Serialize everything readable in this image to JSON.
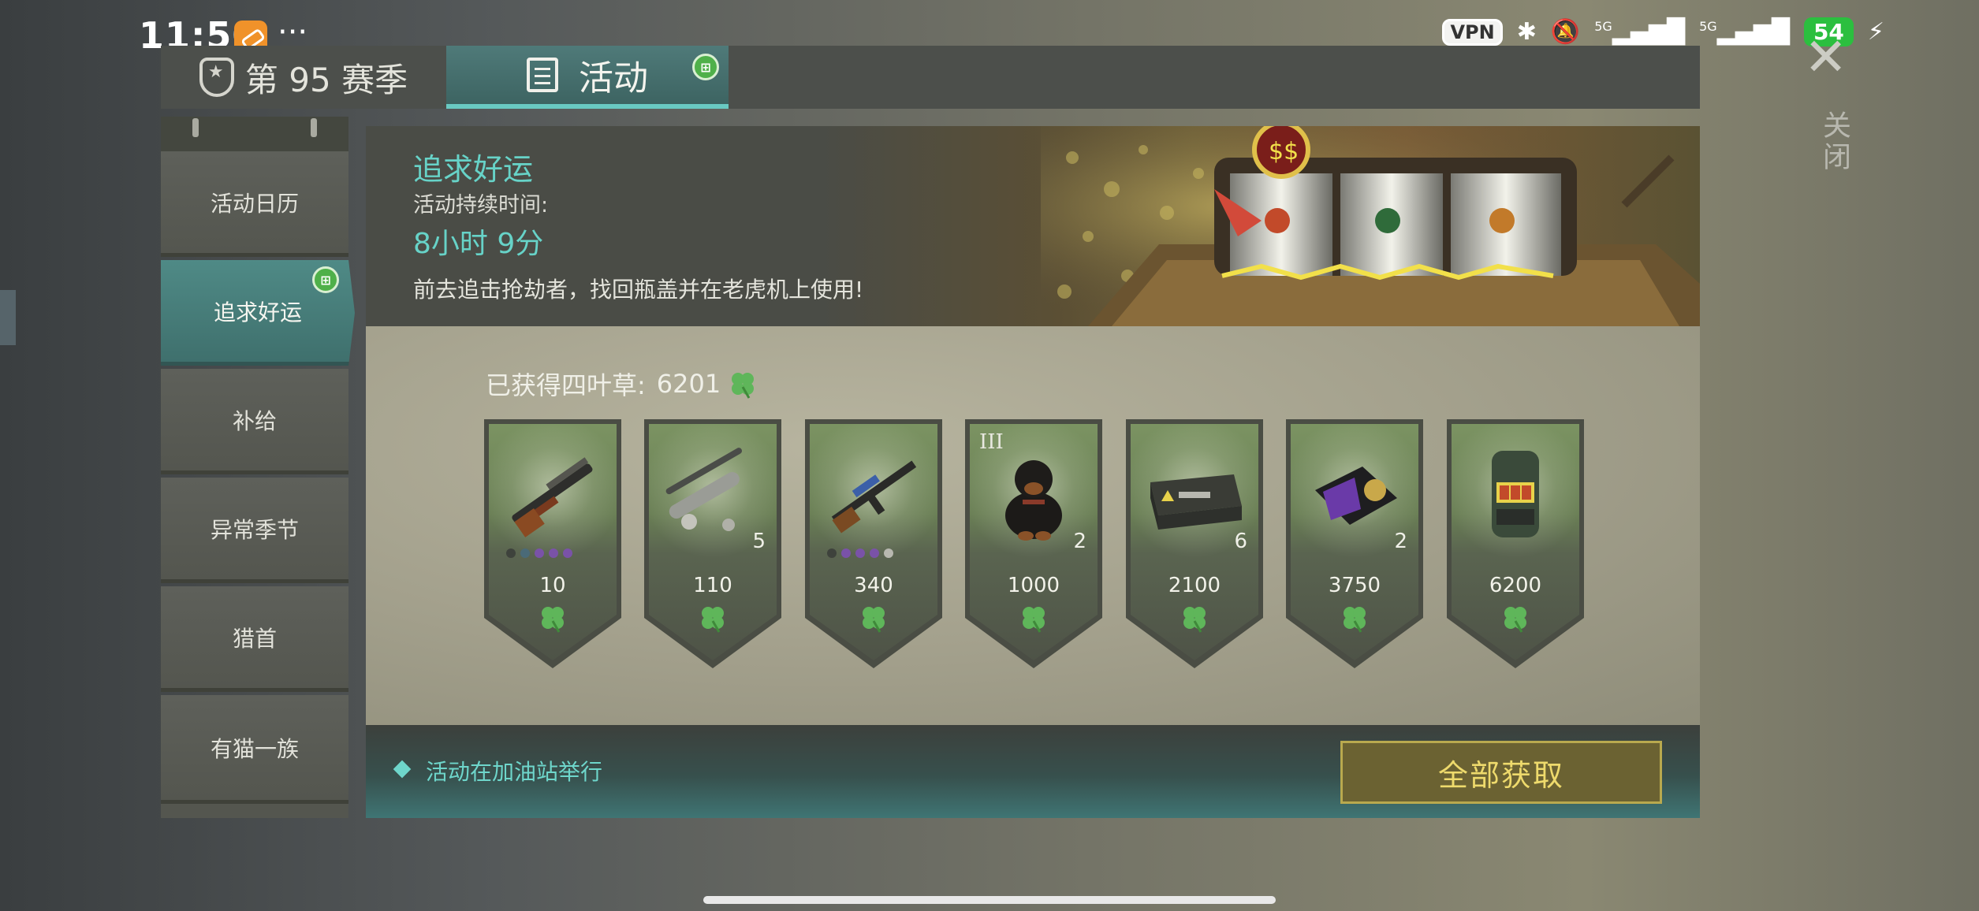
{
  "status_bar": {
    "time": "11:50",
    "more": "···",
    "vpn": "VPN",
    "bluetooth": "✱",
    "mute": "🔕",
    "signal_1": "5G",
    "signal_2": "5G",
    "battery": "54"
  },
  "tabs": {
    "season_label": "第 95 赛季",
    "event_label": "活动"
  },
  "close_label": "关闭",
  "sidebar": {
    "items": [
      {
        "label": "活动日历"
      },
      {
        "label": "追求好运"
      },
      {
        "label": "补给"
      },
      {
        "label": "异常季节"
      },
      {
        "label": "猎首"
      },
      {
        "label": "有猫一族"
      }
    ]
  },
  "banner": {
    "title": "追求好运",
    "duration_label": "活动持续时间:",
    "duration_value": "8小时 9分",
    "description": "前去追击抢劫者，找回瓶盖并在老虎机上使用!"
  },
  "clover": {
    "label": "已获得四叶草:",
    "count": "6201",
    "color": "#5fb65a"
  },
  "rewards": [
    {
      "name": "shotgun",
      "price": "10",
      "qty": "",
      "tier": "",
      "rarity_dots": [
        "#3e423c",
        "#4a6a78",
        "#7a52a8",
        "#7a52a8",
        "#7a52a8"
      ]
    },
    {
      "name": "suppressor-parts",
      "price": "110",
      "qty": "5",
      "tier": "",
      "rarity_dots": []
    },
    {
      "name": "rifle",
      "price": "340",
      "qty": "",
      "tier": "",
      "rarity_dots": [
        "#3e423c",
        "#7a52a8",
        "#7a52a8",
        "#7a52a8",
        "#b8b8b0"
      ]
    },
    {
      "name": "rottweiler",
      "price": "1000",
      "qty": "2",
      "tier": "III",
      "rarity_dots": []
    },
    {
      "name": "weapon-crate",
      "price": "2100",
      "qty": "6",
      "tier": "",
      "rarity_dots": []
    },
    {
      "name": "badge-wallet",
      "price": "3750",
      "qty": "2",
      "tier": "",
      "rarity_dots": []
    },
    {
      "name": "slot-machine",
      "price": "6200",
      "qty": "",
      "tier": "",
      "rarity_dots": []
    }
  ],
  "footer": {
    "note": "活动在加油站举行",
    "claim_all": "全部获取"
  },
  "colors": {
    "accent_teal": "#67d3c8",
    "button_gold": "#eeda6c"
  }
}
